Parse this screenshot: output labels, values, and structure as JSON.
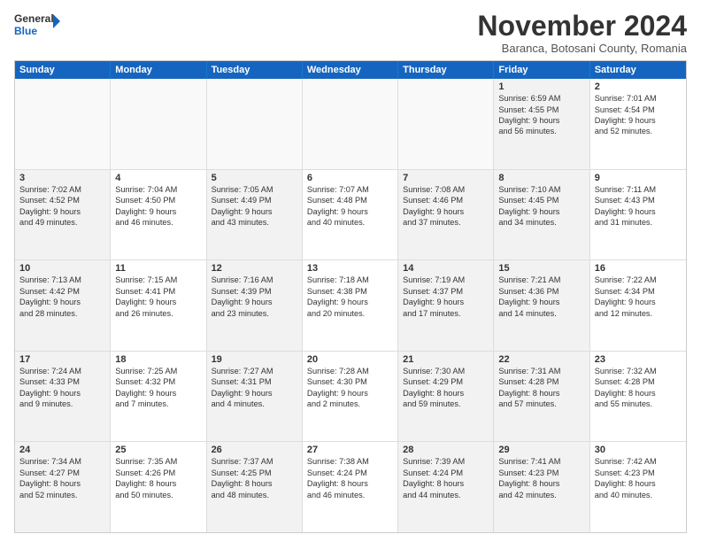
{
  "logo": {
    "line1": "General",
    "line2": "Blue"
  },
  "title": "November 2024",
  "location": "Baranca, Botosani County, Romania",
  "days_of_week": [
    "Sunday",
    "Monday",
    "Tuesday",
    "Wednesday",
    "Thursday",
    "Friday",
    "Saturday"
  ],
  "weeks": [
    [
      {
        "day": "",
        "info": [],
        "empty": true
      },
      {
        "day": "",
        "info": [],
        "empty": true
      },
      {
        "day": "",
        "info": [],
        "empty": true
      },
      {
        "day": "",
        "info": [],
        "empty": true
      },
      {
        "day": "",
        "info": [],
        "empty": true
      },
      {
        "day": "1",
        "info": [
          "Sunrise: 6:59 AM",
          "Sunset: 4:55 PM",
          "Daylight: 9 hours",
          "and 56 minutes."
        ],
        "shaded": true
      },
      {
        "day": "2",
        "info": [
          "Sunrise: 7:01 AM",
          "Sunset: 4:54 PM",
          "Daylight: 9 hours",
          "and 52 minutes."
        ],
        "shaded": false
      }
    ],
    [
      {
        "day": "3",
        "info": [
          "Sunrise: 7:02 AM",
          "Sunset: 4:52 PM",
          "Daylight: 9 hours",
          "and 49 minutes."
        ],
        "shaded": true
      },
      {
        "day": "4",
        "info": [
          "Sunrise: 7:04 AM",
          "Sunset: 4:50 PM",
          "Daylight: 9 hours",
          "and 46 minutes."
        ]
      },
      {
        "day": "5",
        "info": [
          "Sunrise: 7:05 AM",
          "Sunset: 4:49 PM",
          "Daylight: 9 hours",
          "and 43 minutes."
        ],
        "shaded": true
      },
      {
        "day": "6",
        "info": [
          "Sunrise: 7:07 AM",
          "Sunset: 4:48 PM",
          "Daylight: 9 hours",
          "and 40 minutes."
        ]
      },
      {
        "day": "7",
        "info": [
          "Sunrise: 7:08 AM",
          "Sunset: 4:46 PM",
          "Daylight: 9 hours",
          "and 37 minutes."
        ],
        "shaded": true
      },
      {
        "day": "8",
        "info": [
          "Sunrise: 7:10 AM",
          "Sunset: 4:45 PM",
          "Daylight: 9 hours",
          "and 34 minutes."
        ],
        "shaded": true
      },
      {
        "day": "9",
        "info": [
          "Sunrise: 7:11 AM",
          "Sunset: 4:43 PM",
          "Daylight: 9 hours",
          "and 31 minutes."
        ]
      }
    ],
    [
      {
        "day": "10",
        "info": [
          "Sunrise: 7:13 AM",
          "Sunset: 4:42 PM",
          "Daylight: 9 hours",
          "and 28 minutes."
        ],
        "shaded": true
      },
      {
        "day": "11",
        "info": [
          "Sunrise: 7:15 AM",
          "Sunset: 4:41 PM",
          "Daylight: 9 hours",
          "and 26 minutes."
        ]
      },
      {
        "day": "12",
        "info": [
          "Sunrise: 7:16 AM",
          "Sunset: 4:39 PM",
          "Daylight: 9 hours",
          "and 23 minutes."
        ],
        "shaded": true
      },
      {
        "day": "13",
        "info": [
          "Sunrise: 7:18 AM",
          "Sunset: 4:38 PM",
          "Daylight: 9 hours",
          "and 20 minutes."
        ]
      },
      {
        "day": "14",
        "info": [
          "Sunrise: 7:19 AM",
          "Sunset: 4:37 PM",
          "Daylight: 9 hours",
          "and 17 minutes."
        ],
        "shaded": true
      },
      {
        "day": "15",
        "info": [
          "Sunrise: 7:21 AM",
          "Sunset: 4:36 PM",
          "Daylight: 9 hours",
          "and 14 minutes."
        ],
        "shaded": true
      },
      {
        "day": "16",
        "info": [
          "Sunrise: 7:22 AM",
          "Sunset: 4:34 PM",
          "Daylight: 9 hours",
          "and 12 minutes."
        ]
      }
    ],
    [
      {
        "day": "17",
        "info": [
          "Sunrise: 7:24 AM",
          "Sunset: 4:33 PM",
          "Daylight: 9 hours",
          "and 9 minutes."
        ],
        "shaded": true
      },
      {
        "day": "18",
        "info": [
          "Sunrise: 7:25 AM",
          "Sunset: 4:32 PM",
          "Daylight: 9 hours",
          "and 7 minutes."
        ]
      },
      {
        "day": "19",
        "info": [
          "Sunrise: 7:27 AM",
          "Sunset: 4:31 PM",
          "Daylight: 9 hours",
          "and 4 minutes."
        ],
        "shaded": true
      },
      {
        "day": "20",
        "info": [
          "Sunrise: 7:28 AM",
          "Sunset: 4:30 PM",
          "Daylight: 9 hours",
          "and 2 minutes."
        ]
      },
      {
        "day": "21",
        "info": [
          "Sunrise: 7:30 AM",
          "Sunset: 4:29 PM",
          "Daylight: 8 hours",
          "and 59 minutes."
        ],
        "shaded": true
      },
      {
        "day": "22",
        "info": [
          "Sunrise: 7:31 AM",
          "Sunset: 4:28 PM",
          "Daylight: 8 hours",
          "and 57 minutes."
        ],
        "shaded": true
      },
      {
        "day": "23",
        "info": [
          "Sunrise: 7:32 AM",
          "Sunset: 4:28 PM",
          "Daylight: 8 hours",
          "and 55 minutes."
        ]
      }
    ],
    [
      {
        "day": "24",
        "info": [
          "Sunrise: 7:34 AM",
          "Sunset: 4:27 PM",
          "Daylight: 8 hours",
          "and 52 minutes."
        ],
        "shaded": true
      },
      {
        "day": "25",
        "info": [
          "Sunrise: 7:35 AM",
          "Sunset: 4:26 PM",
          "Daylight: 8 hours",
          "and 50 minutes."
        ]
      },
      {
        "day": "26",
        "info": [
          "Sunrise: 7:37 AM",
          "Sunset: 4:25 PM",
          "Daylight: 8 hours",
          "and 48 minutes."
        ],
        "shaded": true
      },
      {
        "day": "27",
        "info": [
          "Sunrise: 7:38 AM",
          "Sunset: 4:24 PM",
          "Daylight: 8 hours",
          "and 46 minutes."
        ]
      },
      {
        "day": "28",
        "info": [
          "Sunrise: 7:39 AM",
          "Sunset: 4:24 PM",
          "Daylight: 8 hours",
          "and 44 minutes."
        ],
        "shaded": true
      },
      {
        "day": "29",
        "info": [
          "Sunrise: 7:41 AM",
          "Sunset: 4:23 PM",
          "Daylight: 8 hours",
          "and 42 minutes."
        ],
        "shaded": true
      },
      {
        "day": "30",
        "info": [
          "Sunrise: 7:42 AM",
          "Sunset: 4:23 PM",
          "Daylight: 8 hours",
          "and 40 minutes."
        ]
      }
    ]
  ]
}
